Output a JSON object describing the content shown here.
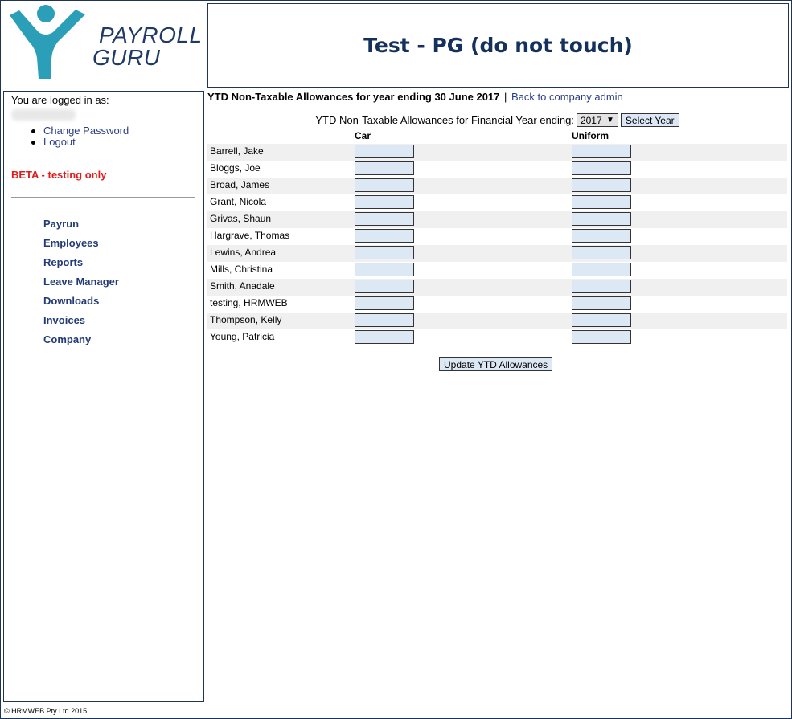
{
  "brand": {
    "line1": "PAYROLL",
    "line2": "GURU",
    "color": "#2a9fb7"
  },
  "header": {
    "title": "Test - PG (do not touch)"
  },
  "sidebar": {
    "logged_in_label": "You are logged in as:",
    "account_links": [
      {
        "label": "Change Password"
      },
      {
        "label": "Logout"
      }
    ],
    "beta_text": "BETA - testing only",
    "nav": [
      {
        "label": "Payrun"
      },
      {
        "label": "Employees"
      },
      {
        "label": "Reports"
      },
      {
        "label": "Leave Manager"
      },
      {
        "label": "Downloads"
      },
      {
        "label": "Invoices"
      },
      {
        "label": "Company"
      }
    ]
  },
  "main": {
    "heading": "YTD Non-Taxable Allowances for year ending 30 June 2017",
    "heading_separator": "|",
    "back_link": "Back to company admin",
    "year_label": "YTD Non-Taxable Allowances for Financial Year ending:",
    "year_value": "2017",
    "select_year_button": "Select Year",
    "columns": [
      "Car",
      "Uniform"
    ],
    "employees": [
      {
        "name": "Barrell, Jake",
        "car": "",
        "uniform": ""
      },
      {
        "name": "Bloggs, Joe",
        "car": "",
        "uniform": ""
      },
      {
        "name": "Broad, James",
        "car": "",
        "uniform": ""
      },
      {
        "name": "Grant, Nicola",
        "car": "",
        "uniform": ""
      },
      {
        "name": "Grivas, Shaun",
        "car": "",
        "uniform": ""
      },
      {
        "name": "Hargrave, Thomas",
        "car": "",
        "uniform": ""
      },
      {
        "name": "Lewins, Andrea",
        "car": "",
        "uniform": ""
      },
      {
        "name": "Mills, Christina",
        "car": "",
        "uniform": ""
      },
      {
        "name": "Smith, Anadale",
        "car": "",
        "uniform": ""
      },
      {
        "name": "testing, HRMWEB",
        "car": "",
        "uniform": ""
      },
      {
        "name": "Thompson, Kelly",
        "car": "",
        "uniform": ""
      },
      {
        "name": "Young, Patricia",
        "car": "",
        "uniform": ""
      }
    ],
    "update_button": "Update YTD Allowances"
  },
  "footer": {
    "copyright": "© HRMWEB Pty Ltd 2015"
  },
  "colors": {
    "link": "#2a3f86",
    "beta": "#e01b1b",
    "input_bg": "#dde8f5",
    "row_shade": "#f0f0f0"
  }
}
